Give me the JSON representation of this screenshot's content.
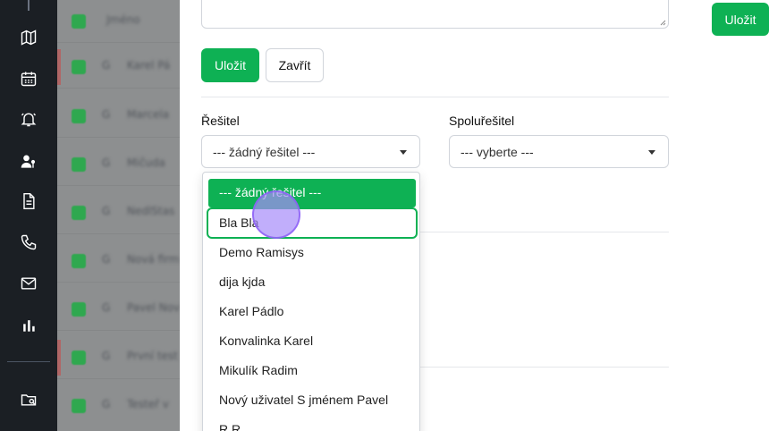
{
  "background_list": {
    "header": "Jméno",
    "rows": [
      {
        "initial": "G",
        "name": "Karel Pá"
      },
      {
        "initial": "G",
        "name": "Marcela"
      },
      {
        "initial": "G",
        "name": "Mičuda"
      },
      {
        "initial": "G",
        "name": "NedlStas"
      },
      {
        "initial": "G",
        "name": "Nová firm"
      },
      {
        "initial": "G",
        "name": "Pavel Nov"
      },
      {
        "initial": "G",
        "name": "První test"
      },
      {
        "initial": "G",
        "name": "Testeř v"
      }
    ]
  },
  "form": {
    "save_label": "Uložit",
    "close_label": "Zavřít",
    "top_save_label": "Uložit"
  },
  "assignee": {
    "label": "Řešitel",
    "value": "--- žádný řešitel ---"
  },
  "coassignee": {
    "label": "Spoluřešitel",
    "value": "--- vyberte ---"
  },
  "dropdown": {
    "options": [
      "--- žádný řešitel ---",
      "Bla Bla",
      "Demo Ramisys",
      "dija kjda",
      "Karel Pádlo",
      "Konvalinka Karel",
      "Mikulík Radim",
      "Nový uživatel S jménem Pavel",
      "R R"
    ]
  },
  "colors": {
    "accent": "#0eb154",
    "nav_bg": "#1b1f24"
  }
}
